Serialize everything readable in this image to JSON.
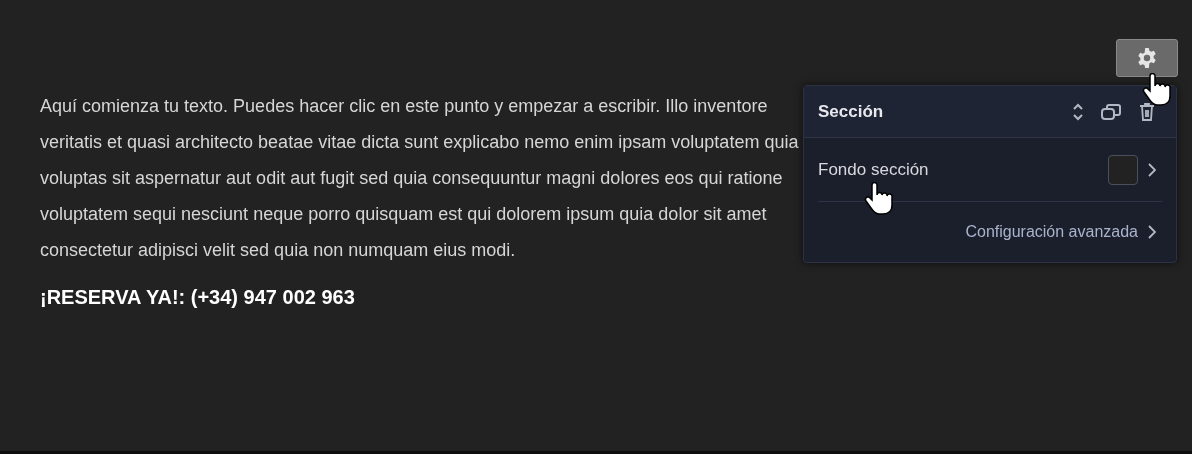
{
  "content": {
    "paragraph": "Aquí comienza tu texto. Puedes hacer clic en este punto y empezar a escribir. Illo inventore veritatis et quasi architecto beatae vitae dicta sunt explicabo nemo enim ipsam voluptatem quia voluptas sit aspernatur aut odit aut fugit sed quia consequuntur magni dolores eos qui ratione voluptatem sequi nesciunt neque porro quisquam est qui dolorem ipsum quia dolor sit amet consectetur adipisci velit sed quia non numquam eius modi.",
    "callout": "¡RESERVA YA!: (+34) 947 002 963"
  },
  "panel": {
    "title": "Sección",
    "background_label": "Fondo sección",
    "advanced_link": "Configuración avanzada"
  }
}
